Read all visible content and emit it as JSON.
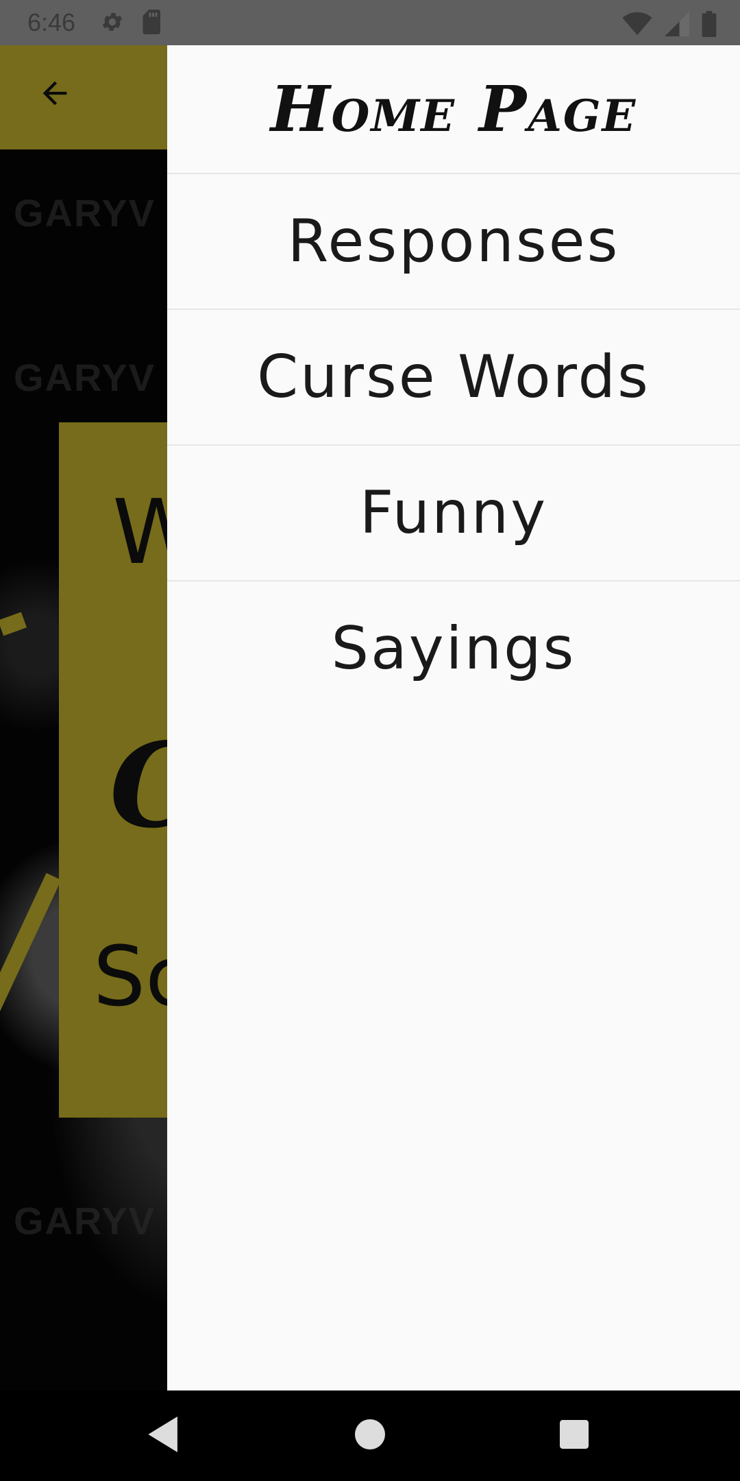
{
  "status_bar": {
    "time": "6:46",
    "left_icons": [
      "settings-icon",
      "sd-card-icon"
    ],
    "right_icons": [
      "wifi-icon",
      "signal-icon",
      "battery-icon"
    ]
  },
  "app_bar": {
    "back_icon": "arrow-back-icon",
    "color": "#b3a52a"
  },
  "background_card": {
    "line1": "W",
    "line2": "C",
    "line3": "Sc"
  },
  "drawer": {
    "title": "Home Page",
    "items": [
      {
        "label": "Responses"
      },
      {
        "label": "Curse Words"
      },
      {
        "label": "Funny"
      },
      {
        "label": "Sayings"
      }
    ]
  },
  "nav_bar": {
    "buttons": [
      "back-triangle-icon",
      "home-circle-icon",
      "recents-square-icon"
    ]
  }
}
